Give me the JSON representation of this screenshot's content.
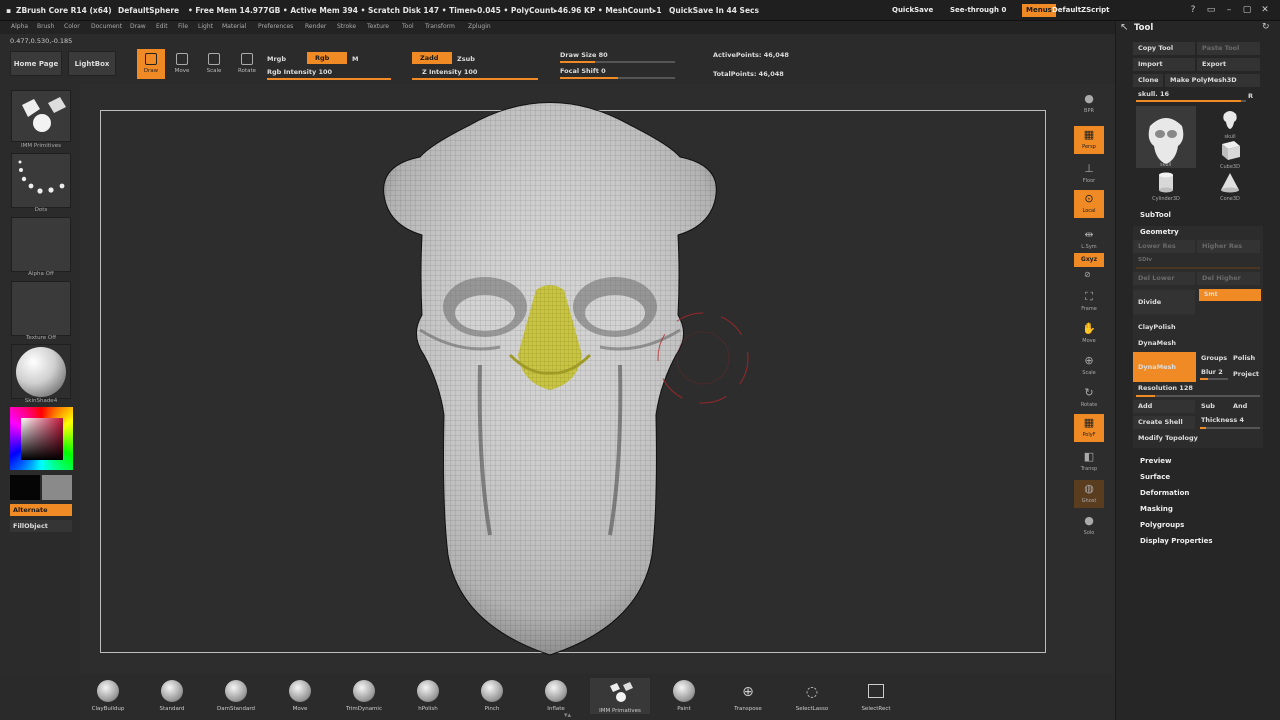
{
  "titlebar": {
    "app": "ZBrush Core R14 (x64)",
    "doc": "DefaultSphere",
    "stats": "• Free Mem 14.977GB • Active Mem 394 • Scratch Disk 147 • Timer▸0.045 • PolyCount▸46.96 KP • MeshCount▸1",
    "quicksave_info": "QuickSave In 44 Secs",
    "quicksave": "QuickSave",
    "see_through": "See-through 0",
    "menus": "Menus",
    "script": "DefaultZScript"
  },
  "menubar": [
    "Alpha",
    "Brush",
    "Color",
    "Document",
    "Draw",
    "Edit",
    "File",
    "Light",
    "Material",
    "Preferences",
    "Render",
    "Stroke",
    "Texture",
    "Tool",
    "Transform",
    "Zplugin"
  ],
  "coords": "0.477,0.530,-0.185",
  "shelf": {
    "home": "Home Page",
    "lightbox": "LightBox",
    "tools": [
      "Draw",
      "Move",
      "Scale",
      "Rotate"
    ],
    "mrgb": "Mrgb",
    "rgb": "Rgb",
    "m": "M",
    "rgb_intensity": "Rgb Intensity 100",
    "zadd": "Zadd",
    "zsub": "Zsub",
    "z_intensity": "Z Intensity 100",
    "draw_size": "Draw Size 80",
    "focal_shift": "Focal Shift 0",
    "active_points": "ActivePoints: 46,048",
    "total_points": "TotalPoints: 46,048"
  },
  "lefttray": {
    "primitives": "IMM Primitives",
    "dots": "Dots",
    "alpha": "Alpha Off",
    "texture": "Texture Off",
    "material": "SkinShade4",
    "alternate": "Alternate",
    "fillobject": "FillObject"
  },
  "righttoolbar": [
    "BPR",
    "Persp",
    "Floor",
    "Local",
    "L.Sym",
    "Gxyz",
    "Frame",
    "Move",
    "Scale",
    "Rotate",
    "PolyF",
    "Transp",
    "Ghost",
    "Solo"
  ],
  "rightpanel": {
    "title": "Tool",
    "copy_tool": "Copy Tool",
    "paste_tool": "Paste Tool",
    "import": "Import",
    "export": "Export",
    "clone": "Clone",
    "make_polymesh": "Make PolyMesh3D",
    "current_tool": "skull. 16",
    "r": "R",
    "tools": [
      "skull",
      "skull",
      "Cube3D",
      "Cylinder3D",
      "Cone3D"
    ],
    "subtool": "SubTool",
    "geometry": "Geometry",
    "lower_res": "Lower Res",
    "higher_res": "Higher Res",
    "sdiv": "SDiv",
    "del_lower": "Del Lower",
    "del_higher": "Del Higher",
    "divide": "Divide",
    "smt": "Smt",
    "claypolish": "ClayPolish",
    "dynamesh_head": "DynaMesh",
    "dynamesh_btn": "DynaMesh",
    "groups": "Groups",
    "polish": "Polish",
    "blur": "Blur 2",
    "project": "Project",
    "resolution": "Resolution 128",
    "add": "Add",
    "sub": "Sub",
    "and": "And",
    "create_shell": "Create Shell",
    "thickness": "Thickness 4",
    "modify_topology": "Modify Topology",
    "sections": [
      "Preview",
      "Surface",
      "Deformation",
      "Masking",
      "Polygroups",
      "Display Properties"
    ]
  },
  "bottomshelf": [
    "ClayBuildup",
    "Standard",
    "DamStandard",
    "Move",
    "TrimDynamic",
    "hPolish",
    "Pinch",
    "Inflate",
    "IMM Primatives",
    "Paint",
    "Transpose",
    "SelectLasso",
    "SelectRect"
  ],
  "colors": {
    "accent": "#f08a24",
    "mask_yellow": "#c8c43a",
    "mesh_gray": "#cfcfcf"
  }
}
